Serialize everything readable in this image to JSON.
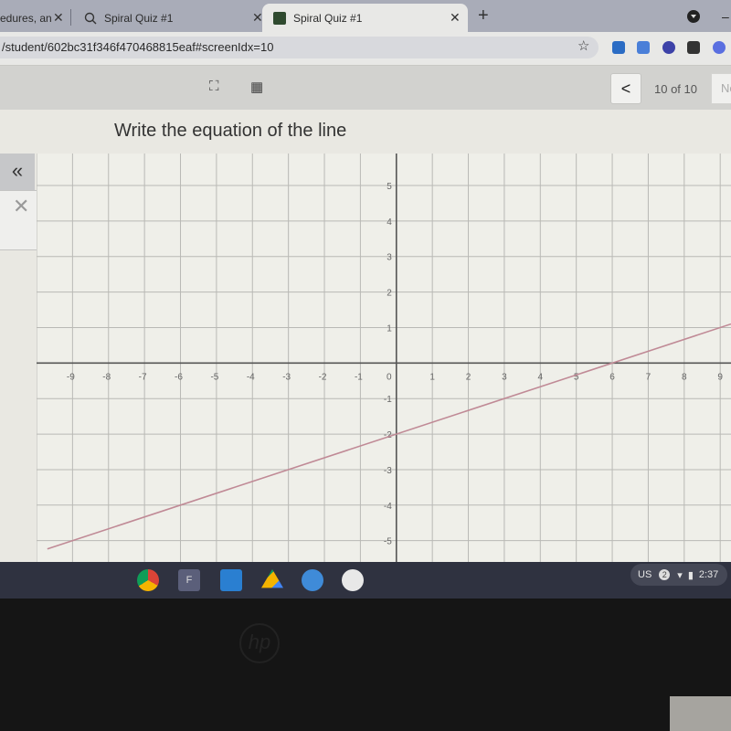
{
  "browser": {
    "tabs": [
      {
        "title": "edures, an",
        "active": false
      },
      {
        "title": "Spiral Quiz #1",
        "active": false
      },
      {
        "title": "Spiral Quiz #1",
        "active": true
      }
    ],
    "close_glyph": "✕",
    "new_tab_glyph": "+",
    "url": "/student/602bc31f346f470468815eaf#screenIdx=10",
    "bookmark_glyph": "☆",
    "extensions": [
      "blue-square-extension",
      "translate-extension",
      "k-extension",
      "dice-extension",
      "gear-extension"
    ]
  },
  "toolbar": {
    "fullscreen_glyph": "⛶",
    "calculator_glyph": "▦",
    "prev_glyph": "<",
    "pager": "10 of 10",
    "next_label": "Next"
  },
  "question": {
    "prompt": "Write the equation of the line",
    "collapse_glyph": "«",
    "close_glyph": "✕"
  },
  "graph": {
    "x_ticks": [
      "-9",
      "-8",
      "-7",
      "-6",
      "-5",
      "-4",
      "-3",
      "-2",
      "-1",
      "0",
      "1",
      "2",
      "3",
      "4",
      "5",
      "6",
      "7",
      "8",
      "9"
    ],
    "y_ticks": [
      "5",
      "4",
      "3",
      "2",
      "1",
      "-1",
      "-2",
      "-3",
      "-4",
      "-5"
    ],
    "x_range": [
      -10,
      9.3
    ],
    "y_range": [
      -5.6,
      5.9
    ],
    "line": {
      "slope": 0.3333,
      "intercept": -2,
      "points": [
        [
          0,
          -2
        ],
        [
          3,
          -1
        ],
        [
          6,
          0
        ],
        [
          9,
          1
        ]
      ],
      "color": "#c08a96"
    }
  },
  "shelf": {
    "apps": [
      "chrome-icon",
      "f-app-icon",
      "shield-app-icon",
      "drive-icon",
      "files-icon",
      "play-store-icon"
    ],
    "tray": {
      "locale": "US",
      "notifications": "2",
      "time": "2:37"
    }
  },
  "device": {
    "logo": "hp"
  }
}
